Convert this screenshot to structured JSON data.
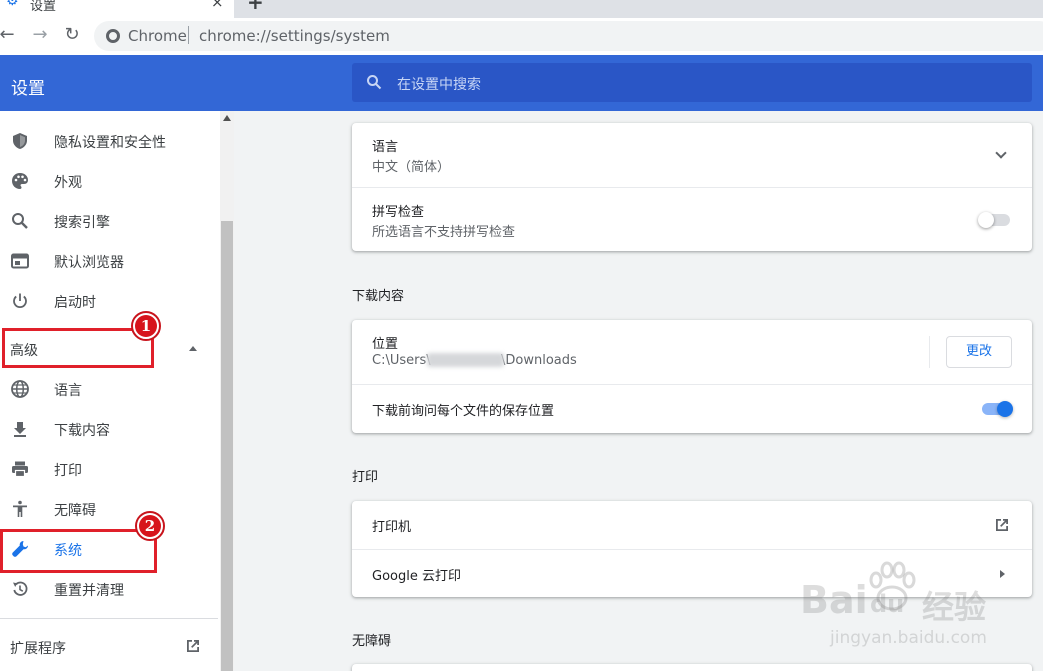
{
  "browser": {
    "tab_title": "设置",
    "new_tab": "+",
    "tab_close": "×",
    "omnibox_site": "Chrome",
    "omnibox_url": "chrome://settings/system"
  },
  "header": {
    "title": "设置",
    "search_placeholder": "在设置中搜索",
    "color": "#3367d6"
  },
  "sidebar": {
    "items": [
      {
        "label": "隐私设置和安全性",
        "icon": "shield-icon"
      },
      {
        "label": "外观",
        "icon": "palette-icon"
      },
      {
        "label": "搜索引擎",
        "icon": "search-icon"
      },
      {
        "label": "默认浏览器",
        "icon": "browser-icon"
      },
      {
        "label": "启动时",
        "icon": "power-icon"
      }
    ],
    "advanced_label": "高级",
    "advanced_items": [
      {
        "label": "语言",
        "icon": "globe-icon"
      },
      {
        "label": "下载内容",
        "icon": "download-icon"
      },
      {
        "label": "打印",
        "icon": "printer-icon"
      },
      {
        "label": "无障碍",
        "icon": "accessibility-icon"
      },
      {
        "label": "系统",
        "icon": "wrench-icon",
        "active": true
      },
      {
        "label": "重置并清理",
        "icon": "restore-icon"
      }
    ],
    "extensions_label": "扩展程序"
  },
  "annotations": {
    "badge1": "1",
    "badge2": "2"
  },
  "main": {
    "language_card": {
      "language_title": "语言",
      "language_value": "中文（简体）",
      "spellcheck_title": "拼写检查",
      "spellcheck_sub": "所选语言不支持拼写检查",
      "spellcheck_enabled": false
    },
    "downloads": {
      "section_title": "下载内容",
      "location_title": "位置",
      "location_path_prefix": "C:\\Users\\",
      "location_path_suffix": "\\Downloads",
      "change_button": "更改",
      "ask_title": "下载前询问每个文件的保存位置",
      "ask_enabled": true
    },
    "print": {
      "section_title": "打印",
      "printers": "打印机",
      "cloud_print": "Google 云打印"
    },
    "accessibility": {
      "section_title": "无障碍"
    }
  },
  "watermark": {
    "brand": "Bai",
    "brand2": "du",
    "cn": "经验",
    "url": "jingyan.baidu.com"
  }
}
